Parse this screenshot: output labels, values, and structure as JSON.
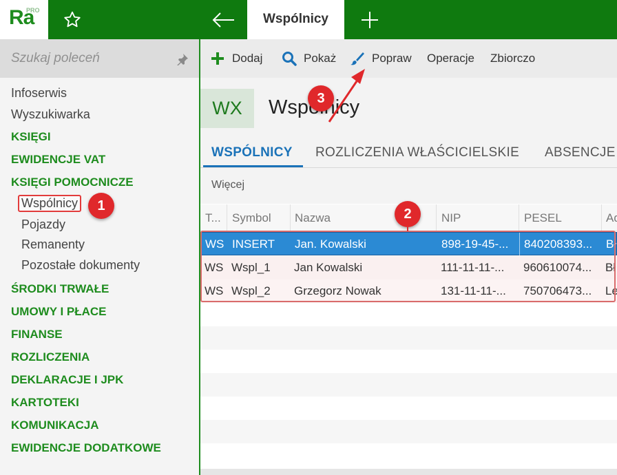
{
  "topbar": {
    "logo": "Ra",
    "logo_badge": "PRO",
    "active_tab": "Wspólnicy",
    "colors": {
      "bar": "#0f7a0f",
      "accent": "#1e8c1e"
    }
  },
  "sidebar": {
    "search_placeholder": "Szukaj poleceń",
    "items": [
      {
        "label": "Infoserwis",
        "type": "item"
      },
      {
        "label": "Wyszukiwarka",
        "type": "item"
      },
      {
        "label": "KSIĘGI",
        "type": "section"
      },
      {
        "label": "EWIDENCJE VAT",
        "type": "section"
      },
      {
        "label": "KSIĘGI POMOCNICZE",
        "type": "section"
      },
      {
        "label": "Wspólnicy",
        "type": "sub",
        "selected": true
      },
      {
        "label": "Pojazdy",
        "type": "sub"
      },
      {
        "label": "Remanenty",
        "type": "sub"
      },
      {
        "label": "Pozostałe dokumenty",
        "type": "sub"
      },
      {
        "label": "ŚRODKI TRWAŁE",
        "type": "section"
      },
      {
        "label": "UMOWY I PŁACE",
        "type": "section"
      },
      {
        "label": "FINANSE",
        "type": "section"
      },
      {
        "label": "ROZLICZENIA",
        "type": "section"
      },
      {
        "label": "DEKLARACJE I JPK",
        "type": "section"
      },
      {
        "label": "KARTOTEKI",
        "type": "section"
      },
      {
        "label": "KOMUNIKACJA",
        "type": "section"
      },
      {
        "label": "EWIDENCJE DODATKOWE",
        "type": "section"
      }
    ]
  },
  "toolbar": {
    "add": "Dodaj",
    "show": "Pokaż",
    "edit": "Popraw",
    "operations": "Operacje",
    "bulk": "Zbiorczo"
  },
  "header": {
    "badge": "WX",
    "title": "Wspólnicy"
  },
  "tabs": [
    "WSPÓLNICY",
    "ROZLICZENIA WŁAŚCICIELSKIE",
    "ABSENCJE"
  ],
  "filter": {
    "more": "Więcej"
  },
  "grid": {
    "columns": [
      "T...",
      "Symbol",
      "Nazwa",
      "NIP",
      "PESEL",
      "Ad"
    ],
    "rows": [
      {
        "type": "WS",
        "symbol": "INSERT",
        "name": "Jan. Kowalski",
        "nip": "898-19-45-...",
        "pesel": "840208393...",
        "addr": "Bł"
      },
      {
        "type": "WS",
        "symbol": "Wspl_1",
        "name": "Jan Kowalski",
        "nip": "111-11-11-...",
        "pesel": "960610074...",
        "addr": "Bł"
      },
      {
        "type": "WS",
        "symbol": "Wspl_2",
        "name": "Grzegorz Nowak",
        "nip": "131-11-11-...",
        "pesel": "750706473...",
        "addr": "Le"
      }
    ]
  },
  "annotations": {
    "b1": "1",
    "b2": "2",
    "b3": "3"
  }
}
